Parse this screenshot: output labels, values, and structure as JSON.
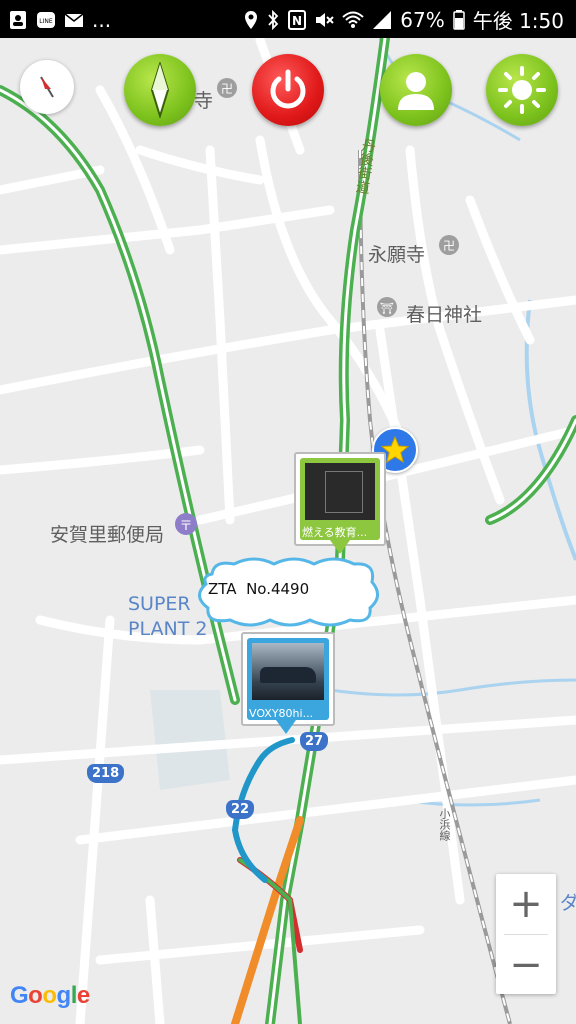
{
  "status_bar": {
    "battery": "67%",
    "time": "午後 1:50",
    "left_icons": [
      "contacts-icon",
      "line-icon",
      "mail-icon",
      "more-icon"
    ],
    "right_icons": [
      "location-icon",
      "bluetooth-icon",
      "nfc-icon",
      "mute-icon",
      "wifi-icon",
      "signal-icon",
      "battery-icon"
    ],
    "more_text": "..."
  },
  "map": {
    "labels": {
      "temple_top": "寺",
      "road_top": "丹後街道",
      "eiganji": "永願寺",
      "kasuga": "春日神社",
      "post_office": "安賀里郵便局",
      "super_plant_1": "SUPER",
      "super_plant_2": "PLANT 2",
      "rail": "小浜線",
      "edge_char": "ダ"
    },
    "route_badges": {
      "r27": "27",
      "r218": "218",
      "r22": "22"
    }
  },
  "markers": {
    "video_marker_caption": "燃える教育...",
    "car_marker_caption": "VOXY80hi...",
    "callout_text": "ZTA  No.4490"
  },
  "zoom": {
    "in": "+",
    "out": "−"
  },
  "attribution": {
    "google": [
      "G",
      "o",
      "o",
      "g",
      "l",
      "e"
    ]
  },
  "colors": {
    "green": "#7cc21d",
    "red": "#e01818",
    "traffic_green": "#4caf50",
    "traffic_orange": "#f08c2a",
    "traffic_red": "#d32f2f",
    "route_blue": "#2196c9",
    "badge_blue": "#3c73c9",
    "star_blue": "#2f78e8"
  }
}
